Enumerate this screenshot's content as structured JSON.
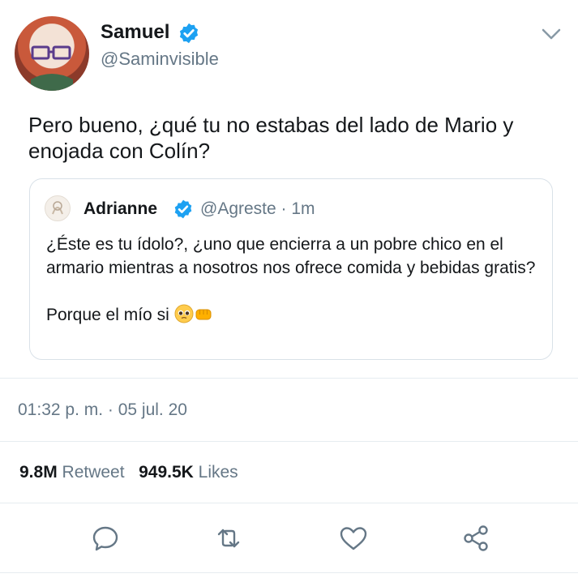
{
  "tweet": {
    "author_name": "Samuel",
    "author_handle": "@Saminvisible",
    "text": "Pero bueno, ¿qué tu no estabas del lado de Mario y enojada con Colín?",
    "timestamp": "01:32 p. m. · 05 jul. 20"
  },
  "quoted": {
    "author_name": "Adrianne",
    "author_handle": "@Agreste · 1m",
    "line1": "¿Éste es tu ídolo?, ¿uno que encierra a un pobre chico en el armario mientras a nosotros nos ofrece comida y bebidas gratis?",
    "line2": "Porque el mío si"
  },
  "stats": {
    "retweets_count": "9.8M",
    "retweets_label": "Retweet",
    "likes_count": "949.5K",
    "likes_label": "Likes"
  },
  "icons": {
    "verified": "verified-badge-icon",
    "caret": "chevron-down-icon",
    "reply": "reply-icon",
    "retweet": "retweet-icon",
    "like": "heart-icon",
    "share": "share-icon",
    "emoji1": "pleading-face-emoji",
    "emoji2": "fist-emoji"
  },
  "colors": {
    "accent": "#1da1f2",
    "secondary_text": "#657786",
    "border": "#e6ecf0"
  }
}
